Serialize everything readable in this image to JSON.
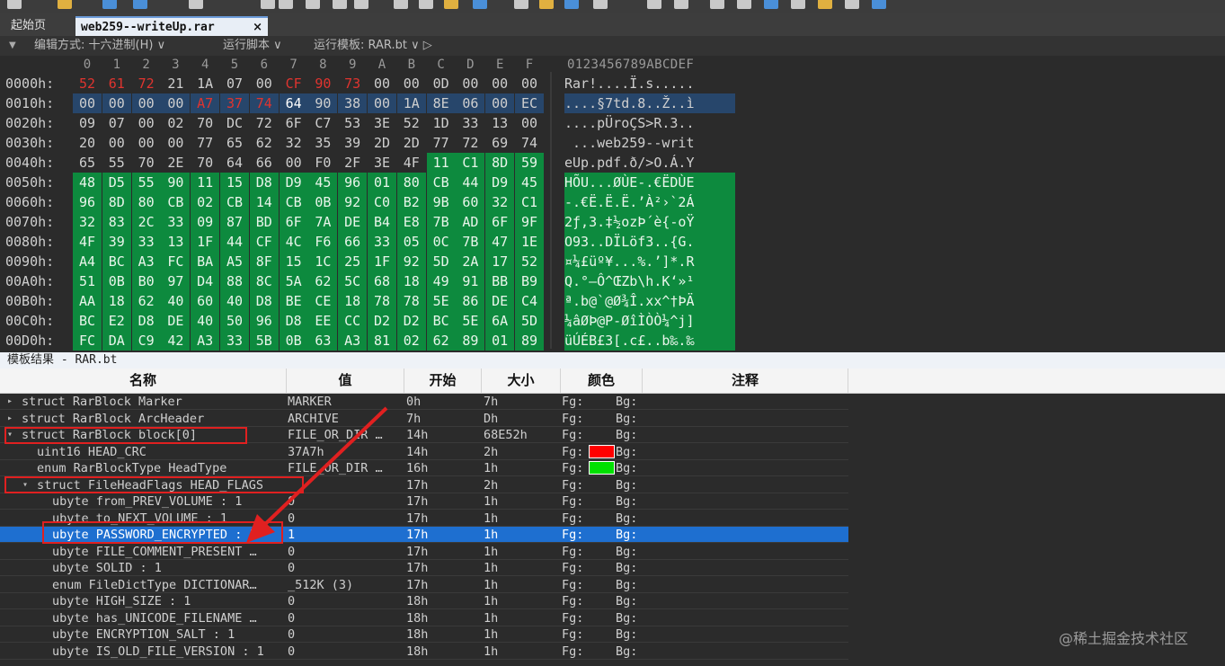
{
  "tabs": {
    "home": "起始页",
    "active_file": "web259--writeUp.rar",
    "close": "×"
  },
  "editor_bar": {
    "edit_mode": "编辑方式: 十六进制(H) ∨",
    "run_script": "运行脚本 ∨",
    "run_template": "运行模板: RAR.bt ∨ ▷"
  },
  "hex": {
    "column_headers": [
      "0",
      "1",
      "2",
      "3",
      "4",
      "5",
      "6",
      "7",
      "8",
      "9",
      "A",
      "B",
      "C",
      "D",
      "E",
      "F"
    ],
    "ascii_header": "0123456789ABCDEF",
    "rows": [
      {
        "addr": "0000h:",
        "bytes": [
          "52",
          "61",
          "72",
          "21",
          "1A",
          "07",
          "00",
          "CF",
          "90",
          "73",
          "00",
          "00",
          "0D",
          "00",
          "00",
          "00"
        ],
        "ascii": "Rar!....Ï.s....."
      },
      {
        "addr": "0010h:",
        "bytes": [
          "00",
          "00",
          "00",
          "00",
          "A7",
          "37",
          "74",
          "64",
          "90",
          "38",
          "00",
          "1A",
          "8E",
          "06",
          "00",
          "EC"
        ],
        "ascii": "....§7td.8..Ž..ì"
      },
      {
        "addr": "0020h:",
        "bytes": [
          "09",
          "07",
          "00",
          "02",
          "70",
          "DC",
          "72",
          "6F",
          "C7",
          "53",
          "3E",
          "52",
          "1D",
          "33",
          "13",
          "00"
        ],
        "ascii": "....pÜroÇS>R.3.."
      },
      {
        "addr": "0030h:",
        "bytes": [
          "20",
          "00",
          "00",
          "00",
          "77",
          "65",
          "62",
          "32",
          "35",
          "39",
          "2D",
          "2D",
          "77",
          "72",
          "69",
          "74"
        ],
        "ascii": " ...web259--writ"
      },
      {
        "addr": "0040h:",
        "bytes": [
          "65",
          "55",
          "70",
          "2E",
          "70",
          "64",
          "66",
          "00",
          "F0",
          "2F",
          "3E",
          "4F",
          "11",
          "C1",
          "8D",
          "59"
        ],
        "ascii": "eUp.pdf.ð/>O.Á.Y"
      },
      {
        "addr": "0050h:",
        "bytes": [
          "48",
          "D5",
          "55",
          "90",
          "11",
          "15",
          "D8",
          "D9",
          "45",
          "96",
          "01",
          "80",
          "CB",
          "44",
          "D9",
          "45"
        ],
        "ascii": "HÕU...ØÙE-.€ËDÙE"
      },
      {
        "addr": "0060h:",
        "bytes": [
          "96",
          "8D",
          "80",
          "CB",
          "02",
          "CB",
          "14",
          "CB",
          "0B",
          "92",
          "C0",
          "B2",
          "9B",
          "60",
          "32",
          "C1"
        ],
        "ascii": "-.€Ë.Ë.Ë.’À²›`2Á"
      },
      {
        "addr": "0070h:",
        "bytes": [
          "32",
          "83",
          "2C",
          "33",
          "09",
          "87",
          "BD",
          "6F",
          "7A",
          "DE",
          "B4",
          "E8",
          "7B",
          "AD",
          "6F",
          "9F"
        ],
        "ascii": "2ƒ,3.‡½ozÞ´è{-oŸ"
      },
      {
        "addr": "0080h:",
        "bytes": [
          "4F",
          "39",
          "33",
          "13",
          "1F",
          "44",
          "CF",
          "4C",
          "F6",
          "66",
          "33",
          "05",
          "0C",
          "7B",
          "47",
          "1E"
        ],
        "ascii": "O93..DÏLöf3..{G."
      },
      {
        "addr": "0090h:",
        "bytes": [
          "A4",
          "BC",
          "A3",
          "FC",
          "BA",
          "A5",
          "8F",
          "15",
          "1C",
          "25",
          "1F",
          "92",
          "5D",
          "2A",
          "17",
          "52"
        ],
        "ascii": "¤¼£üº¥...%.’]*.R"
      },
      {
        "addr": "00A0h:",
        "bytes": [
          "51",
          "0B",
          "B0",
          "97",
          "D4",
          "88",
          "8C",
          "5A",
          "62",
          "5C",
          "68",
          "18",
          "49",
          "91",
          "BB",
          "B9"
        ],
        "ascii": "Q.°—Ô^ŒZb\\h.K‘»¹"
      },
      {
        "addr": "00B0h:",
        "bytes": [
          "AA",
          "18",
          "62",
          "40",
          "60",
          "40",
          "D8",
          "BE",
          "CE",
          "18",
          "78",
          "78",
          "5E",
          "86",
          "DE",
          "C4"
        ],
        "ascii": "ª.b@`@Ø¾Î.xx^†ÞÄ"
      },
      {
        "addr": "00C0h:",
        "bytes": [
          "BC",
          "E2",
          "D8",
          "DE",
          "40",
          "50",
          "96",
          "D8",
          "EE",
          "CC",
          "D2",
          "D2",
          "BC",
          "5E",
          "6A",
          "5D"
        ],
        "ascii": "¼âØÞ@P-ØîÌÒÒ¼^j]"
      },
      {
        "addr": "00D0h:",
        "bytes": [
          "FC",
          "DA",
          "C9",
          "42",
          "A3",
          "33",
          "5B",
          "0B",
          "63",
          "A3",
          "81",
          "02",
          "62",
          "89",
          "01",
          "89"
        ],
        "ascii": "üÚÉB£3[.c£..b‰.‰"
      }
    ]
  },
  "template": {
    "title": "模板结果 - RAR.bt",
    "headers": {
      "name": "名称",
      "value": "值",
      "start": "开始",
      "size": "大小",
      "color": "颜色",
      "comment": "注释"
    },
    "fg_label": "Fg:",
    "bg_label": "Bg:",
    "colors": {
      "red_swatch": "#ff0000",
      "green_swatch": "#00e000",
      "selected_row": "#1e6fd0"
    },
    "rows": [
      {
        "name": "struct RarBlock Marker",
        "value": "MARKER",
        "start": "0h",
        "size": "7h"
      },
      {
        "name": "struct RarBlock ArcHeader",
        "value": "ARCHIVE",
        "start": "7h",
        "size": "Dh"
      },
      {
        "name": "struct RarBlock block[0]",
        "value": "FILE_OR_DIR …",
        "start": "14h",
        "size": "68E52h"
      },
      {
        "name": "uint16 HEAD_CRC",
        "value": "37A7h",
        "start": "14h",
        "size": "2h"
      },
      {
        "name": "enum RarBlockType HeadType",
        "value": "FILE_OR_DIR …",
        "start": "16h",
        "size": "1h"
      },
      {
        "name": "struct FileHeadFlags HEAD_FLAGS",
        "value": "",
        "start": "17h",
        "size": "2h"
      },
      {
        "name": "ubyte from_PREV_VOLUME : 1",
        "value": "0",
        "start": "17h",
        "size": "1h"
      },
      {
        "name": "ubyte to_NEXT_VOLUME : 1",
        "value": "0",
        "start": "17h",
        "size": "1h"
      },
      {
        "name": "ubyte PASSWORD_ENCRYPTED : 1",
        "value": "1",
        "start": "17h",
        "size": "1h"
      },
      {
        "name": "ubyte FILE_COMMENT_PRESENT …",
        "value": "0",
        "start": "17h",
        "size": "1h"
      },
      {
        "name": "ubyte SOLID : 1",
        "value": "0",
        "start": "17h",
        "size": "1h"
      },
      {
        "name": "enum FileDictType DICTIONAR…",
        "value": "_512K (3)",
        "start": "17h",
        "size": "1h"
      },
      {
        "name": "ubyte HIGH_SIZE : 1",
        "value": "0",
        "start": "18h",
        "size": "1h"
      },
      {
        "name": "ubyte has_UNICODE_FILENAME …",
        "value": "0",
        "start": "18h",
        "size": "1h"
      },
      {
        "name": "ubyte ENCRYPTION_SALT : 1",
        "value": "0",
        "start": "18h",
        "size": "1h"
      },
      {
        "name": "ubyte IS_OLD_FILE_VERSION : 1",
        "value": "0",
        "start": "18h",
        "size": "1h"
      }
    ]
  },
  "watermark": "@稀土掘金技术社区"
}
